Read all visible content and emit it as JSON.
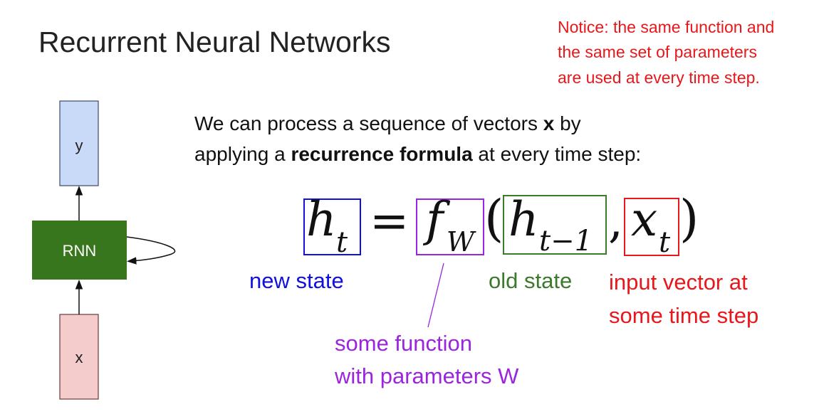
{
  "slide": {
    "title": "Recurrent Neural Networks"
  },
  "notice": {
    "lines": [
      "Notice: the same function and",
      "the same set of parameters",
      "are used at every time step."
    ]
  },
  "description": {
    "line1_pre": "We can process a sequence of vectors ",
    "line1_bold": "x",
    "line1_post": " by",
    "line2_pre": "applying a ",
    "line2_bold": "recurrence formula",
    "line2_post": " at every time step:"
  },
  "diagram": {
    "output_label": "y",
    "rnn_label": "RNN",
    "input_label": "x"
  },
  "equation": {
    "h": "h",
    "t_sub": "t",
    "equals": "=",
    "f": "f",
    "w_sub": "W",
    "open_paren": "(",
    "h_prev": "h",
    "t_minus_1_sub": "t−1",
    "comma": ",",
    "x": "x",
    "x_sub": "t",
    "close_paren": ")"
  },
  "annotations": {
    "new_state": "new state",
    "old_state": "old state",
    "input_vector_line1": "input vector at",
    "input_vector_line2": "some time step",
    "function_line1": "some function",
    "function_line2": "with parameters W"
  },
  "colors": {
    "new_state": "#1010e0",
    "function": "#9b24e0",
    "old_state": "#3a7a2a",
    "input": "#e8171b",
    "rnn_box": "#38761d",
    "y_box": "#c9daf8",
    "x_box": "#f4cccc"
  }
}
